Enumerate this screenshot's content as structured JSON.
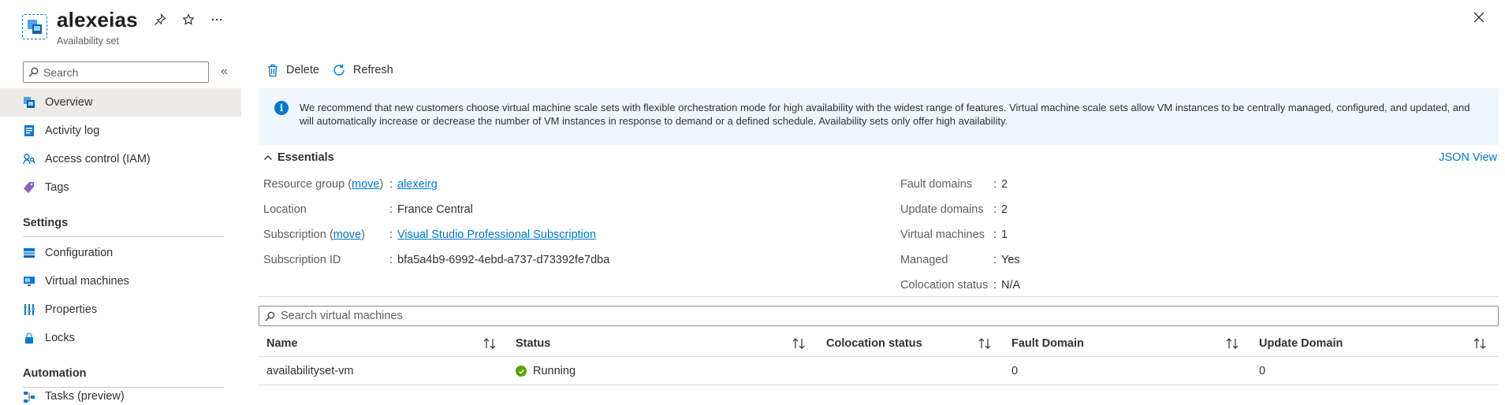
{
  "header": {
    "title": "alexeias",
    "subtitle": "Availability set",
    "pin_icon": "pin-icon",
    "favorite_icon": "star-icon",
    "more_icon": "ellipsis-icon",
    "close_icon": "close-icon"
  },
  "sidebar": {
    "search_placeholder": "Search",
    "collapse_icon": "double-chevron-left-icon",
    "items": [
      {
        "label": "Overview",
        "icon": "overview-icon",
        "active": true
      },
      {
        "label": "Activity log",
        "icon": "activity-log-icon"
      },
      {
        "label": "Access control (IAM)",
        "icon": "iam-icon"
      },
      {
        "label": "Tags",
        "icon": "tag-icon"
      }
    ],
    "sections": [
      {
        "title": "Settings",
        "items": [
          {
            "label": "Configuration",
            "icon": "configuration-icon"
          },
          {
            "label": "Virtual machines",
            "icon": "virtual-machine-icon"
          },
          {
            "label": "Properties",
            "icon": "properties-icon"
          },
          {
            "label": "Locks",
            "icon": "lock-icon"
          }
        ]
      },
      {
        "title": "Automation",
        "items": [
          {
            "label": "Tasks (preview)",
            "icon": "tasks-icon"
          }
        ]
      }
    ]
  },
  "toolbar": {
    "delete_label": "Delete",
    "refresh_label": "Refresh"
  },
  "info_banner": {
    "text": "We recommend that new customers choose virtual machine scale sets with flexible orchestration mode for high availability with the widest range of features. Virtual machine scale sets allow VM instances to be centrally managed, configured, and updated, and will automatically increase or decrease the number of VM instances in response to demand or a defined schedule. Availability sets only offer high availability."
  },
  "essentials": {
    "title": "Essentials",
    "json_view": "JSON View",
    "left": [
      {
        "label": "Resource group",
        "move": "move",
        "value": "alexeirg",
        "is_link": true
      },
      {
        "label": "Location",
        "value": "France Central"
      },
      {
        "label": "Subscription",
        "move": "move",
        "value": "Visual Studio Professional Subscription",
        "is_link": true
      },
      {
        "label": "Subscription ID",
        "value": "bfa5a4b9-6992-4ebd-a737-d73392fe7dba"
      }
    ],
    "right": [
      {
        "label": "Fault domains",
        "value": "2"
      },
      {
        "label": "Update domains",
        "value": "2"
      },
      {
        "label": "Virtual machines",
        "value": "1"
      },
      {
        "label": "Managed",
        "value": "Yes"
      },
      {
        "label": "Colocation status",
        "value": "N/A"
      }
    ]
  },
  "vm_table": {
    "search_placeholder": "Search virtual machines",
    "columns": [
      "Name",
      "Status",
      "Colocation status",
      "Fault Domain",
      "Update Domain"
    ],
    "rows": [
      {
        "name": "availabilityset-vm",
        "status": "Running",
        "colocation": "",
        "fault_domain": "0",
        "update_domain": "0"
      }
    ]
  },
  "colors": {
    "accent": "#0078d4",
    "running": "#57a300"
  }
}
